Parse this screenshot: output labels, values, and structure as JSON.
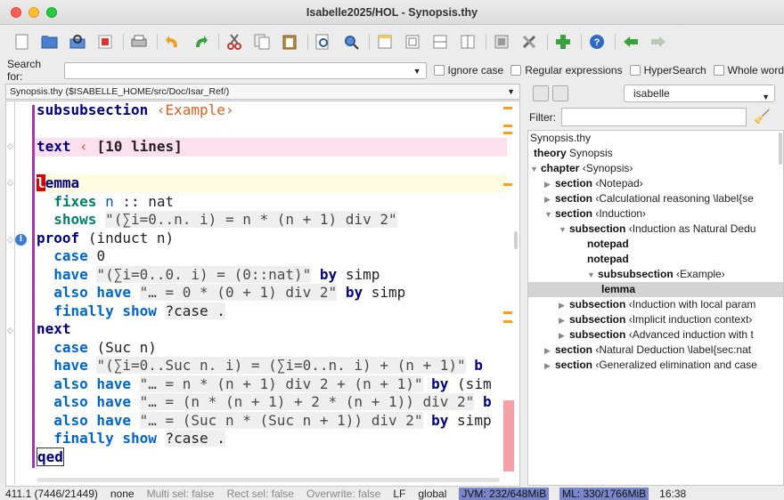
{
  "window": {
    "title": "Isabelle2025/HOL - Synopsis.thy"
  },
  "toolbar": {
    "buttons": [
      "new-file-icon",
      "open-file-icon",
      "reload-icon",
      "close-buffer-icon",
      "print-icon",
      "undo-icon",
      "redo-icon",
      "cut-icon",
      "copy-icon",
      "paste-icon",
      "find-icon",
      "find-in-files-icon",
      "new-view-icon",
      "unsplit-icon",
      "split-horizontal-icon",
      "split-vertical-icon",
      "buffer-options-icon",
      "global-options-icon",
      "plugin-manager-icon",
      "help-icon",
      "back-icon",
      "forward-icon"
    ]
  },
  "search": {
    "label": "Search for:",
    "value": "",
    "ignore_case": "Ignore case",
    "regex": "Regular expressions",
    "hypersearch": "HyperSearch",
    "whole_word": "Whole word"
  },
  "file": {
    "selector": "Synopsis.thy ($ISABELLE_HOME/src/Doc/Isar_Ref/)"
  },
  "editor": {
    "l1_kw": "subsubsection",
    "l1_cart": "‹Example›",
    "l2_kw": "text",
    "l2_cart": "‹",
    "l2_fold": "[10 lines]",
    "l3_cursor": "l",
    "l3_rest": "emma",
    "l4_kw": "fixes",
    "l4_var": "n",
    "l4_rest": ":: nat",
    "l5_kw": "shows",
    "l5_str": "\"(∑i=0..n. i) = n * (n + 1) div 2\"",
    "l6_kw": "proof",
    "l6_rest": "(induct n)",
    "l7_kw": "case",
    "l7_rest": "0",
    "l8_kw": "have",
    "l8_str": "\"(∑i=0..0. i) = (0::nat)\"",
    "l8_by": "by",
    "l8_m": "simp",
    "l9_kw": "also have",
    "l9_str": "\"… = 0 * (0 + 1) div 2\"",
    "l9_by": "by",
    "l9_m": "simp",
    "l10_kw": "finally show",
    "l10_rest": "?case .",
    "l11_kw": "next",
    "l12_kw": "case",
    "l12_rest": "(Suc n)",
    "l13_kw": "have",
    "l13_str": "\"(∑i=0..Suc n. i) = (∑i=0..n. i) + (n + 1)\"",
    "l13_by": "b",
    "l14_kw": "also have",
    "l14_str": "\"… = n * (n + 1) div 2 + (n + 1)\"",
    "l14_by": "by",
    "l14_m": "(sim",
    "l15_kw": "also have",
    "l15_str": "\"… = (n * (n + 1) + 2 * (n + 1)) div 2\"",
    "l15_by": "b",
    "l16_kw": "also have",
    "l16_str": "\"… = (Suc n * (Suc n + 1)) div 2\"",
    "l16_by": "by",
    "l16_m": "simp",
    "l17_kw": "finally show",
    "l17_rest": "?case .",
    "l18_kw": "qed"
  },
  "sidebar": {
    "mode_select": "isabelle",
    "filter_label": "Filter:",
    "filter_value": "",
    "tree": [
      {
        "t": "Synopsis.thy",
        "b": ""
      },
      {
        "t": " Synopsis",
        "b": "theory"
      },
      {
        "t": " ‹Synopsis›",
        "b": "chapter"
      },
      {
        "t": " ‹Notepad›",
        "b": "section"
      },
      {
        "t": " ‹Calculational reasoning \\label{se",
        "b": "section"
      },
      {
        "t": " ‹Induction›",
        "b": "section"
      },
      {
        "t": " ‹Induction as Natural Dedu",
        "b": "subsection"
      },
      {
        "t": "",
        "b": "notepad"
      },
      {
        "t": "",
        "b": "notepad"
      },
      {
        "t": " ‹Example›",
        "b": "subsubsection"
      },
      {
        "t": "",
        "b": "lemma"
      },
      {
        "t": " ‹Induction with local param",
        "b": "subsection"
      },
      {
        "t": " ‹Implicit induction context›",
        "b": "subsection"
      },
      {
        "t": " ‹Advanced induction with t",
        "b": "subsection"
      },
      {
        "t": " ‹Natural Deduction \\label{sec:nat",
        "b": "section"
      },
      {
        "t": " ‹Generalized elimination and case",
        "b": "section"
      }
    ]
  },
  "status": {
    "pos": "411.1 (7446/21449)",
    "mode": "none",
    "multi": "Multi sel: false",
    "rect": "Rect sel: false",
    "overwrite": "Overwrite: false",
    "lf": "LF",
    "global": "global",
    "jvm": "JVM: 232/648MiB",
    "ml": "ML: 330/1766MiB",
    "time": "16:38"
  },
  "colors": {
    "keyword": "#000080",
    "command": "#0066cc",
    "cartouche": "#e06020",
    "variable": "#0055cc",
    "pink_highlight": "#fde0ee",
    "purple_bar": "#a038a8",
    "warning": "#f7a11a",
    "error_bar": "#f7a0a8"
  }
}
